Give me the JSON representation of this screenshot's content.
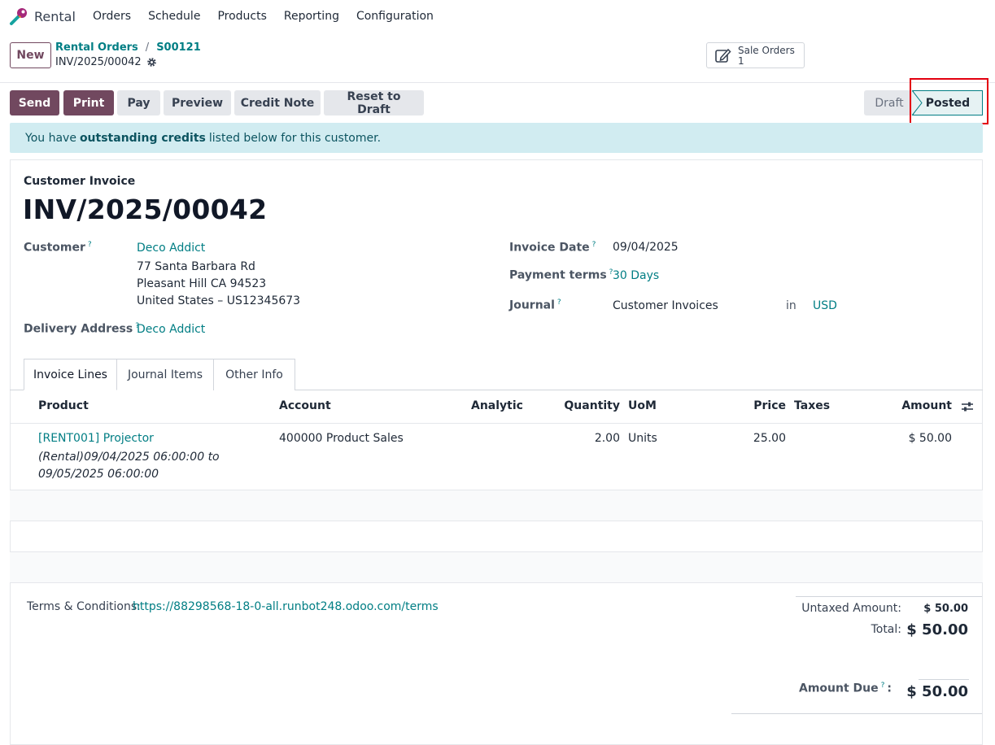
{
  "navbar": {
    "app_name": "Rental",
    "menu": [
      "Orders",
      "Schedule",
      "Products",
      "Reporting",
      "Configuration"
    ]
  },
  "control": {
    "new_label": "New",
    "breadcrumb": [
      "Rental Orders",
      "S00121"
    ],
    "record_name": "INV/2025/00042",
    "smart_button": {
      "label": "Sale Orders",
      "count": "1"
    }
  },
  "actions": [
    "Send",
    "Print",
    "Pay",
    "Preview",
    "Credit Note",
    "Reset to Draft"
  ],
  "status": {
    "draft": "Draft",
    "posted": "Posted"
  },
  "alert": {
    "prefix": "You have",
    "bold": "outstanding credits",
    "suffix": "listed below for this customer."
  },
  "invoice": {
    "type": "Customer Invoice",
    "name": "INV/2025/00042",
    "customer_label": "Customer",
    "customer": "Deco Addict",
    "address": [
      "77 Santa Barbara Rd",
      "Pleasant Hill CA 94523",
      "United States – US12345673"
    ],
    "delivery_label": "Delivery Address",
    "delivery": "Deco Addict",
    "invoice_date_label": "Invoice Date",
    "invoice_date": "09/04/2025",
    "payment_terms_label": "Payment terms",
    "payment_terms": "30 Days",
    "journal_label": "Journal",
    "journal": "Customer Invoices",
    "in_label": "in",
    "currency": "USD",
    "help_mark": "?"
  },
  "tabs": [
    "Invoice Lines",
    "Journal Items",
    "Other Info"
  ],
  "table": {
    "headers": {
      "product": "Product",
      "account": "Account",
      "analytic": "Analytic",
      "quantity": "Quantity",
      "uom": "UoM",
      "price": "Price",
      "taxes": "Taxes",
      "amount": "Amount"
    },
    "rows": [
      {
        "product": "[RENT001] Projector",
        "description": "(Rental)09/04/2025 06:00:00 to 09/05/2025 06:00:00",
        "account": "400000 Product Sales",
        "quantity": "2.00",
        "uom": "Units",
        "price": "25.00",
        "amount": "$ 50.00"
      }
    ]
  },
  "footer": {
    "terms_label": "Terms & Conditions:",
    "terms_link": "https://88298568-18-0-all.runbot248.odoo.com/terms",
    "untaxed_label": "Untaxed Amount:",
    "untaxed": "$ 50.00",
    "total_label": "Total:",
    "total": "$ 50.00",
    "amount_due_label": "Amount Due",
    "amount_due_suffix": ":",
    "amount_due": "$ 50.00"
  },
  "colors": {
    "brand": "#71485f",
    "link": "#017e84",
    "highlight": "#e3000f"
  }
}
